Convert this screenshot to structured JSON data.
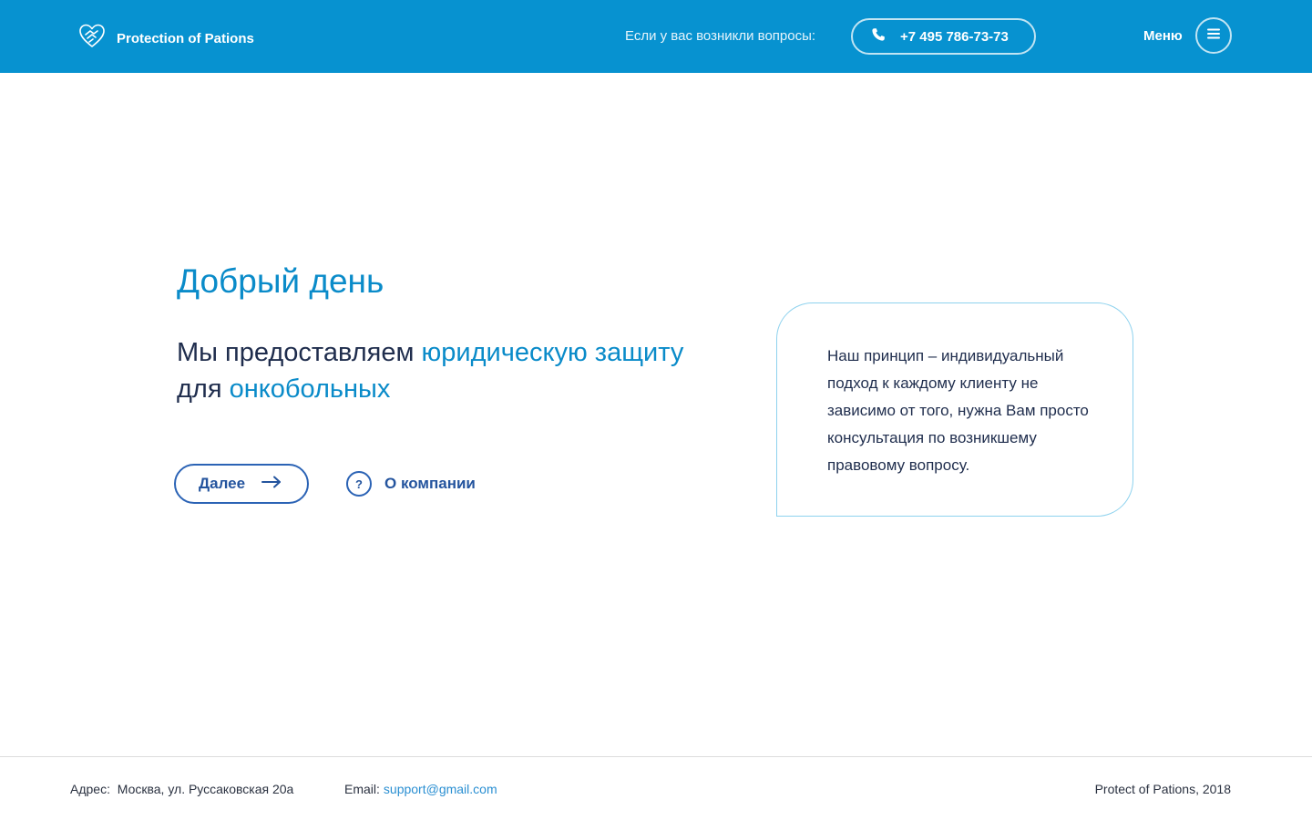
{
  "header": {
    "brand": "Protection of Pations",
    "questions_text": "Если у вас возникли вопросы:",
    "phone": "+7 495 786-73-73",
    "menu_label": "Меню"
  },
  "hero": {
    "greeting": "Добрый день",
    "tagline_part1": "Мы предоставляем ",
    "tagline_hl1": "юридическую защиту",
    "tagline_part2": " для ",
    "tagline_hl2": "онкобольных",
    "next_button": "Далее",
    "about_icon": "?",
    "about_link": "О компании"
  },
  "card": {
    "text": "Наш принцип – индивидуальный подход к каждому клиенту не зависимо от того, нужна Вам просто консультация по возникшему правовому вопросу."
  },
  "footer": {
    "address_label": "Адрес:",
    "address_value": "Москва, ул. Руссаковская 20а",
    "email_label": "Email:",
    "email_value": "support@gmail.com",
    "copyright": "Protect of Pations, 2018"
  },
  "colors": {
    "header_bg": "#0792d0",
    "accent": "#0a8bc9",
    "button_blue": "#24549e"
  },
  "icons": {
    "logo": "heart-hands-icon",
    "phone": "phone-icon",
    "menu": "hamburger-icon",
    "next": "arrow-right-icon",
    "about": "question-circle-icon"
  }
}
